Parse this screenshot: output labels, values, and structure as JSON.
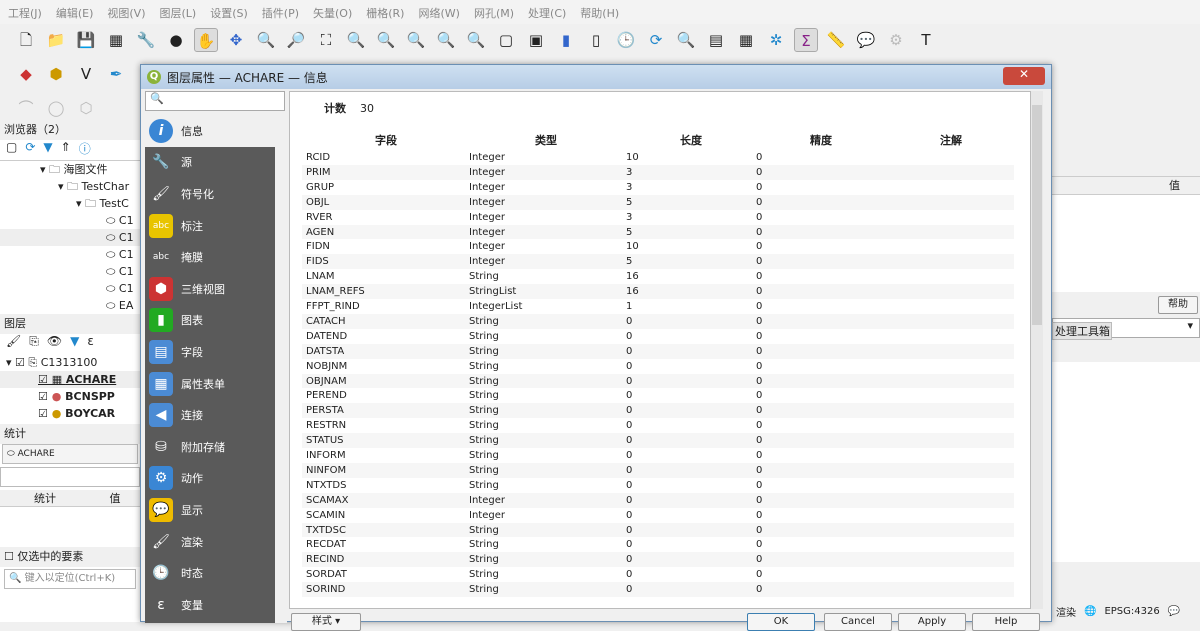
{
  "menu": [
    "工程(J)",
    "编辑(E)",
    "视图(V)",
    "图层(L)",
    "设置(S)",
    "插件(P)",
    "矢量(O)",
    "栅格(R)",
    "网络(W)",
    "网孔(M)",
    "处理(C)",
    "帮助(H)"
  ],
  "browser": {
    "title": "浏览器（2）",
    "items": [
      "海图文件",
      "TestChar",
      "TestC",
      "C1",
      "C1",
      "C1",
      "C1",
      "C1",
      "EA"
    ]
  },
  "layers": {
    "title": "图层",
    "group": "C1313100",
    "items": [
      "ACHARE",
      "BCNSPP",
      "BOYCAR"
    ]
  },
  "stats": {
    "title": "统计",
    "layer": "ACHARE",
    "col_stat": "统计",
    "col_value": "值",
    "selected_only": "仅选中的要素"
  },
  "locator": {
    "placeholder": "键入以定位(Ctrl+K)"
  },
  "dialog": {
    "title": "图层属性 — ACHARE — 信息",
    "close": "✕",
    "nav": [
      "信息",
      "源",
      "符号化",
      "标注",
      "掩膜",
      "三维视图",
      "图表",
      "字段",
      "属性表单",
      "连接",
      "附加存储",
      "动作",
      "显示",
      "渲染",
      "时态",
      "变量"
    ],
    "count_label": "计数",
    "count_value": "30",
    "headers": [
      "字段",
      "类型",
      "长度",
      "精度",
      "注解"
    ],
    "fields": [
      [
        "RCID",
        "Integer",
        "10",
        "0"
      ],
      [
        "PRIM",
        "Integer",
        "3",
        "0"
      ],
      [
        "GRUP",
        "Integer",
        "3",
        "0"
      ],
      [
        "OBJL",
        "Integer",
        "5",
        "0"
      ],
      [
        "RVER",
        "Integer",
        "3",
        "0"
      ],
      [
        "AGEN",
        "Integer",
        "5",
        "0"
      ],
      [
        "FIDN",
        "Integer",
        "10",
        "0"
      ],
      [
        "FIDS",
        "Integer",
        "5",
        "0"
      ],
      [
        "LNAM",
        "String",
        "16",
        "0"
      ],
      [
        "LNAM_REFS",
        "StringList",
        "16",
        "0"
      ],
      [
        "FFPT_RIND",
        "IntegerList",
        "1",
        "0"
      ],
      [
        "CATACH",
        "String",
        "0",
        "0"
      ],
      [
        "DATEND",
        "String",
        "0",
        "0"
      ],
      [
        "DATSTA",
        "String",
        "0",
        "0"
      ],
      [
        "NOBJNM",
        "String",
        "0",
        "0"
      ],
      [
        "OBJNAM",
        "String",
        "0",
        "0"
      ],
      [
        "PEREND",
        "String",
        "0",
        "0"
      ],
      [
        "PERSTA",
        "String",
        "0",
        "0"
      ],
      [
        "RESTRN",
        "String",
        "0",
        "0"
      ],
      [
        "STATUS",
        "String",
        "0",
        "0"
      ],
      [
        "INFORM",
        "String",
        "0",
        "0"
      ],
      [
        "NINFOM",
        "String",
        "0",
        "0"
      ],
      [
        "NTXTDS",
        "String",
        "0",
        "0"
      ],
      [
        "SCAMAX",
        "Integer",
        "0",
        "0"
      ],
      [
        "SCAMIN",
        "Integer",
        "0",
        "0"
      ],
      [
        "TXTDSC",
        "String",
        "0",
        "0"
      ],
      [
        "RECDAT",
        "String",
        "0",
        "0"
      ],
      [
        "RECIND",
        "String",
        "0",
        "0"
      ],
      [
        "SORDAT",
        "String",
        "0",
        "0"
      ],
      [
        "SORIND",
        "String",
        "0",
        "0"
      ]
    ],
    "style_btn": "样式",
    "ok": "OK",
    "cancel": "Cancel",
    "apply": "Apply",
    "help": "Help"
  },
  "right": {
    "value_col": "值",
    "help": "帮助",
    "toolbox_tab": "处理工具箱"
  },
  "status": {
    "render": "渲染",
    "crs": "EPSG:4326"
  }
}
